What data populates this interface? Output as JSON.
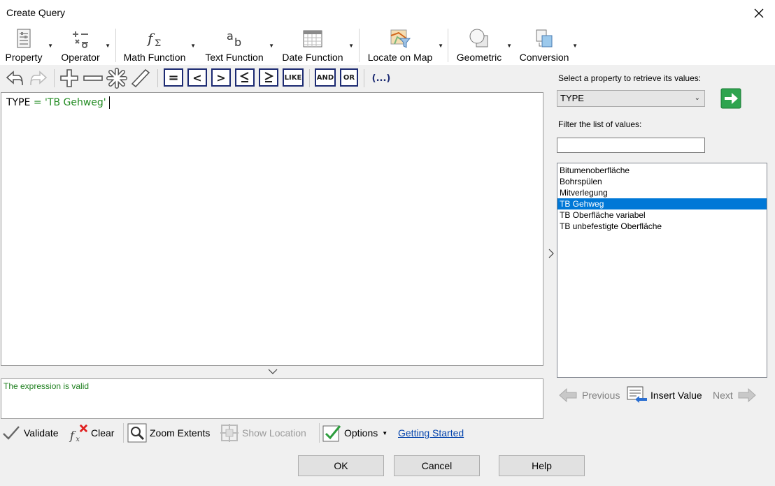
{
  "window": {
    "title": "Create Query"
  },
  "ribbon": {
    "property": "Property",
    "operator": "Operator",
    "math_function": "Math Function",
    "text_function": "Text Function",
    "date_function": "Date Function",
    "locate_on_map": "Locate on Map",
    "geometric": "Geometric",
    "conversion": "Conversion"
  },
  "toolbar": {
    "equals": "=",
    "less": "<",
    "greater": ">",
    "like": "LIKE",
    "and": "AND",
    "or": "OR",
    "parens": "(...)"
  },
  "editor": {
    "field": "TYPE",
    "operator": "=",
    "value": "'TB Gehweg'"
  },
  "status": {
    "message": "The expression is valid"
  },
  "right_panel": {
    "select_label": "Select a property to retrieve its values:",
    "selected_property": "TYPE",
    "filter_label": "Filter the list of values:",
    "filter_value": "",
    "values": [
      "Bitumenoberfläche",
      "Bohrspülen",
      "Mitverlegung",
      "TB Gehweg",
      "TB Oberfläche variabel",
      "TB unbefestigte Oberfläche"
    ],
    "selected_value": "TB Gehweg",
    "previous": "Previous",
    "insert_value": "Insert Value",
    "next": "Next"
  },
  "commands": {
    "validate": "Validate",
    "clear": "Clear",
    "zoom_extents": "Zoom Extents",
    "show_location": "Show Location",
    "options": "Options",
    "getting_started": "Getting Started"
  },
  "dialog": {
    "ok": "OK",
    "cancel": "Cancel",
    "help": "Help"
  },
  "colors": {
    "selection": "#0078d7",
    "valid_text": "#208020",
    "string_literal": "#228b22",
    "operator_box": "#1c2a72",
    "link": "#0645ad"
  }
}
